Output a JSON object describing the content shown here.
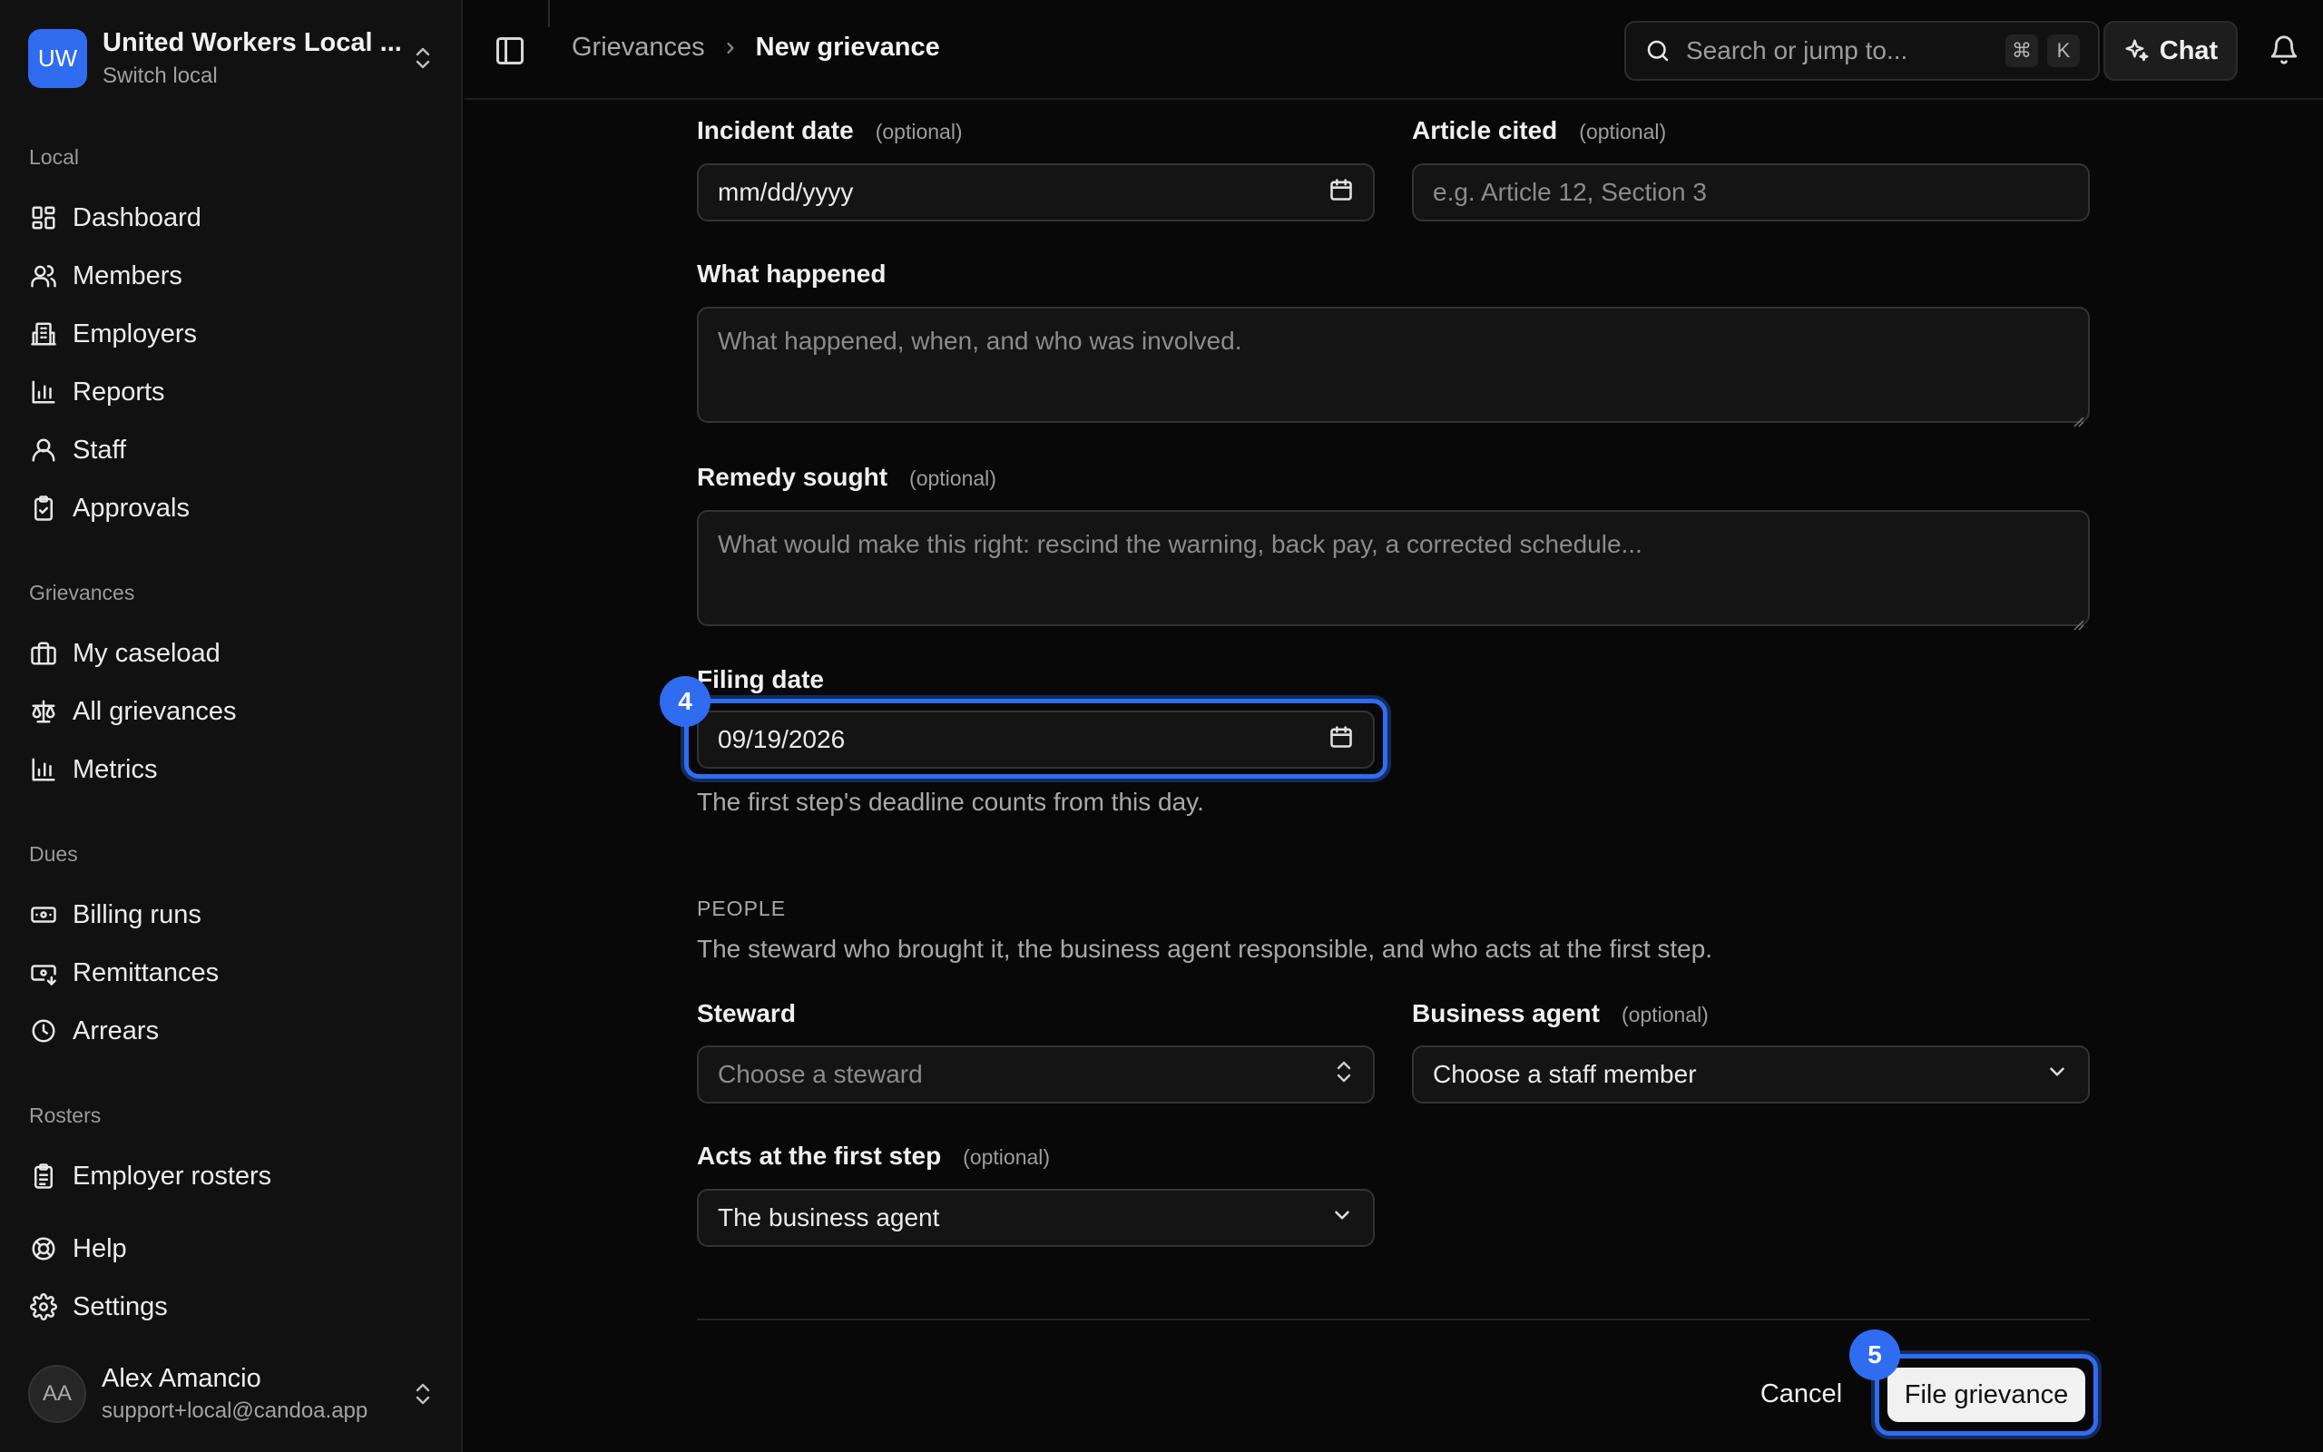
{
  "org": {
    "initials": "UW",
    "name": "United Workers Local ...",
    "switch_label": "Switch local"
  },
  "sidebar": {
    "sections": [
      {
        "label": "Local"
      },
      {
        "label": "Grievances"
      },
      {
        "label": "Dues"
      },
      {
        "label": "Rosters"
      }
    ],
    "items": [
      {
        "label": "Dashboard",
        "icon": "dashboard-icon"
      },
      {
        "label": "Members",
        "icon": "members-icon"
      },
      {
        "label": "Employers",
        "icon": "building-icon"
      },
      {
        "label": "Reports",
        "icon": "bar-chart-icon"
      },
      {
        "label": "Staff",
        "icon": "user-icon"
      },
      {
        "label": "Approvals",
        "icon": "clipboard-check-icon"
      },
      {
        "label": "My caseload",
        "icon": "briefcase-icon"
      },
      {
        "label": "All grievances",
        "icon": "scale-icon"
      },
      {
        "label": "Metrics",
        "icon": "bar-chart-icon"
      },
      {
        "label": "Billing runs",
        "icon": "banknote-icon"
      },
      {
        "label": "Remittances",
        "icon": "banknote-arrow-icon"
      },
      {
        "label": "Arrears",
        "icon": "clock-icon"
      },
      {
        "label": "Employer rosters",
        "icon": "clipboard-list-icon"
      },
      {
        "label": "Help",
        "icon": "lifebuoy-icon"
      },
      {
        "label": "Settings",
        "icon": "gear-icon"
      }
    ]
  },
  "user": {
    "initials": "AA",
    "name": "Alex Amancio",
    "email": "support+local@candoa.app"
  },
  "topbar": {
    "breadcrumb": [
      "Grievances",
      "New grievance"
    ],
    "search_placeholder": "Search or jump to...",
    "search_shortcut": [
      "⌘",
      "K"
    ],
    "chat_label": "Chat"
  },
  "form": {
    "incident_date": {
      "label": "Incident date",
      "optional": "(optional)",
      "placeholder": "mm/dd/yyyy"
    },
    "article_cited": {
      "label": "Article cited",
      "optional": "(optional)",
      "placeholder": "e.g. Article 12, Section 3"
    },
    "what_happened": {
      "label": "What happened",
      "placeholder": "What happened, when, and who was involved."
    },
    "remedy_sought": {
      "label": "Remedy sought",
      "optional": "(optional)",
      "placeholder": "What would make this right: rescind the warning, back pay, a corrected schedule..."
    },
    "filing_date": {
      "label": "Filing date",
      "value": "09/19/2026",
      "help": "The first step's deadline counts from this day.",
      "step": "4"
    },
    "people": {
      "heading": "PEOPLE",
      "description": "The steward who brought it, the business agent responsible, and who acts at the first step.",
      "steward": {
        "label": "Steward",
        "placeholder": "Choose a steward"
      },
      "business_agent": {
        "label": "Business agent",
        "optional": "(optional)",
        "value": "Choose a staff member"
      },
      "first_step": {
        "label": "Acts at the first step",
        "optional": "(optional)",
        "value": "The business agent"
      }
    },
    "cancel_label": "Cancel",
    "submit_label": "File grievance",
    "submit_step": "5"
  },
  "colors": {
    "accent": "#2f6cf0",
    "background": "#080808",
    "sidebar": "#111111"
  }
}
